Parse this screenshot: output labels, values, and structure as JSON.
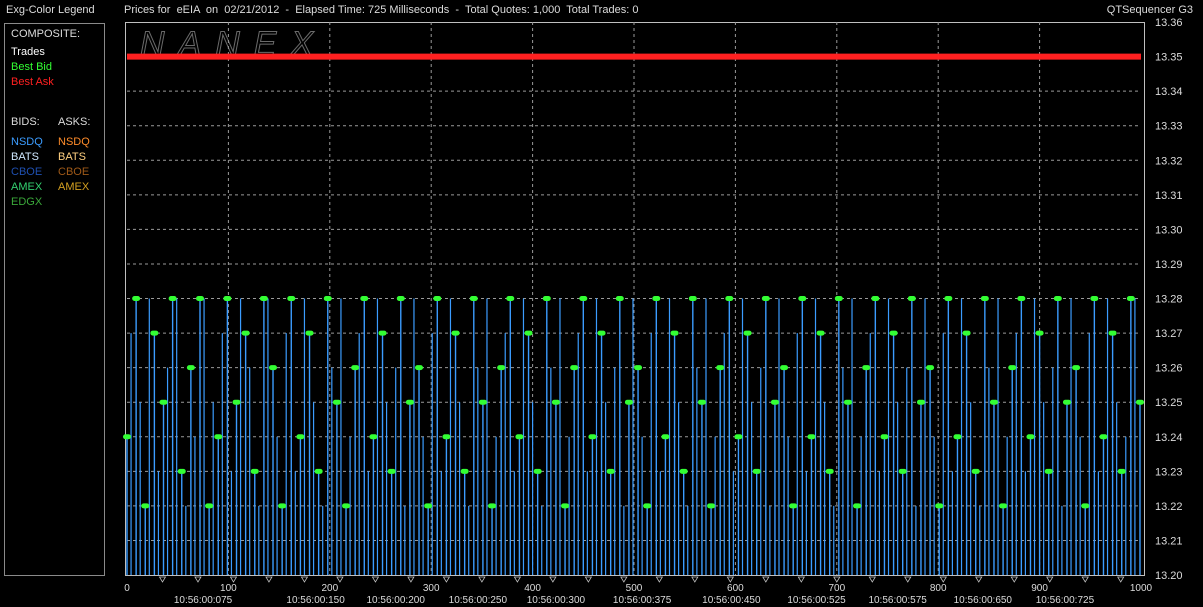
{
  "header": {
    "legend_title": "Exg-Color Legend",
    "chart_title": "Prices for  eEIA  on  02/21/2012  -  Elapsed Time: 725 Milliseconds  -  Total Quotes: 1,000  Total Trades: 0",
    "app_name": "QTSequencer G3"
  },
  "watermark": "NANEX",
  "legend": {
    "composite_header": "COMPOSITE:",
    "composite": [
      {
        "label": "Trades",
        "color": "#ffffff"
      },
      {
        "label": "Best Bid",
        "color": "#33ff33"
      },
      {
        "label": "Best Ask",
        "color": "#ff2020"
      }
    ],
    "bids_header": "BIDS:",
    "asks_header": "ASKS:",
    "bids": [
      {
        "label": "NSDQ",
        "color": "#3b9cff"
      },
      {
        "label": "BATS",
        "color": "#cfe8ff"
      },
      {
        "label": "CBOE",
        "color": "#1f4fb0"
      },
      {
        "label": "AMEX",
        "color": "#33d070"
      },
      {
        "label": "EDGX",
        "color": "#3aa83a"
      }
    ],
    "asks": [
      {
        "label": "NSDQ",
        "color": "#ff8c2a"
      },
      {
        "label": "BATS",
        "color": "#ffd080"
      },
      {
        "label": "CBOE",
        "color": "#a05a18"
      },
      {
        "label": "AMEX",
        "color": "#d4a020"
      }
    ]
  },
  "chart_data": {
    "type": "line",
    "xlim": [
      0,
      1000
    ],
    "ylim": [
      13.2,
      13.36
    ],
    "x_ticks": [
      0,
      100,
      200,
      300,
      400,
      500,
      600,
      700,
      800,
      900,
      1000
    ],
    "y_ticks": [
      "13.20",
      "13.21",
      "13.22",
      "13.23",
      "13.24",
      "13.25",
      "13.26",
      "13.27",
      "13.28",
      "13.29",
      "13.30",
      "13.31",
      "13.32",
      "13.33",
      "13.34",
      "13.35",
      "13.36"
    ],
    "time_labels": [
      "10:56:00:075",
      "10:56:00:150",
      "10:56:00:200",
      "10:56:00:250",
      "10:56:00:300",
      "10:56:00:375",
      "10:56:00:450",
      "10:56:00:525",
      "10:56:00:575",
      "10:56:00:650",
      "10:56:00:725"
    ],
    "time_label_x": [
      75,
      186,
      265,
      346,
      423,
      508,
      596,
      680,
      760,
      844,
      925
    ],
    "grid": true,
    "series": [
      {
        "name": "Best Ask",
        "color": "#ff2020",
        "x": [
          0,
          1000
        ],
        "values": [
          13.35,
          13.35
        ]
      },
      {
        "name": "Best Bid",
        "color": "#33ff33",
        "x": [
          0,
          9,
          18,
          27,
          36,
          45,
          54,
          63,
          72,
          81,
          90,
          99,
          108,
          117,
          126,
          135,
          144,
          153,
          162,
          171,
          180,
          189,
          198,
          207,
          216,
          225,
          234,
          243,
          252,
          261,
          270,
          279,
          288,
          297,
          306,
          315,
          324,
          333,
          342,
          351,
          360,
          369,
          378,
          387,
          396,
          405,
          414,
          423,
          432,
          441,
          450,
          459,
          468,
          477,
          486,
          495,
          504,
          513,
          522,
          531,
          540,
          549,
          558,
          567,
          576,
          585,
          594,
          603,
          612,
          621,
          630,
          639,
          648,
          657,
          666,
          675,
          684,
          693,
          702,
          711,
          720,
          729,
          738,
          747,
          756,
          765,
          774,
          783,
          792,
          801,
          810,
          819,
          828,
          837,
          846,
          855,
          864,
          873,
          882,
          891,
          900,
          909,
          918,
          927,
          936,
          945,
          954,
          963,
          972,
          981,
          990,
          999
        ],
        "values": [
          13.24,
          13.28,
          13.22,
          13.27,
          13.25,
          13.28,
          13.23,
          13.26,
          13.28,
          13.22,
          13.24,
          13.28,
          13.25,
          13.27,
          13.23,
          13.28,
          13.26,
          13.22,
          13.28,
          13.24,
          13.27,
          13.23,
          13.28,
          13.25,
          13.22,
          13.26,
          13.28,
          13.24,
          13.27,
          13.23,
          13.28,
          13.25,
          13.26,
          13.22,
          13.28,
          13.24,
          13.27,
          13.23,
          13.28,
          13.25,
          13.22,
          13.26,
          13.28,
          13.24,
          13.27,
          13.23,
          13.28,
          13.25,
          13.22,
          13.26,
          13.28,
          13.24,
          13.27,
          13.23,
          13.28,
          13.25,
          13.26,
          13.22,
          13.28,
          13.24,
          13.27,
          13.23,
          13.28,
          13.25,
          13.22,
          13.26,
          13.28,
          13.24,
          13.27,
          13.23,
          13.28,
          13.25,
          13.26,
          13.22,
          13.28,
          13.24,
          13.27,
          13.23,
          13.28,
          13.25,
          13.22,
          13.26,
          13.28,
          13.24,
          13.27,
          13.23,
          13.28,
          13.25,
          13.26,
          13.22,
          13.28,
          13.24,
          13.27,
          13.23,
          13.28,
          13.25,
          13.22,
          13.26,
          13.28,
          13.24,
          13.27,
          13.23,
          13.28,
          13.25,
          13.26,
          13.22,
          13.28,
          13.24,
          13.27,
          13.23,
          13.28,
          13.25
        ]
      }
    ]
  }
}
